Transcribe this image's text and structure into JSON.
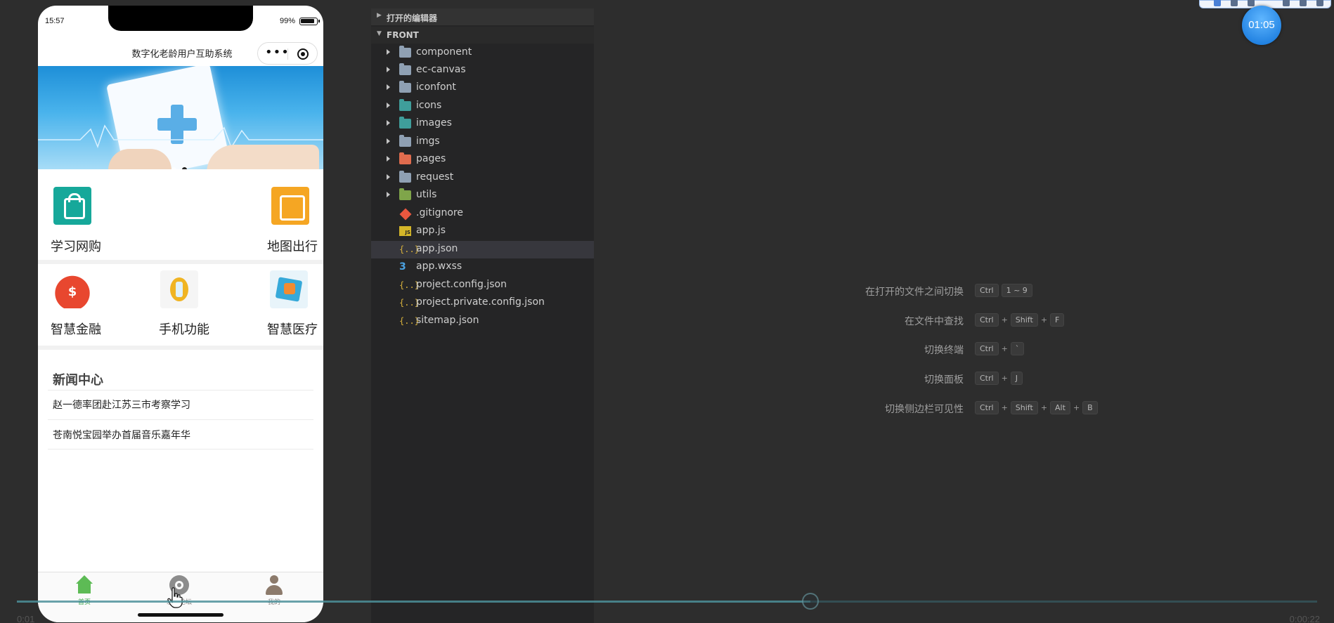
{
  "phone": {
    "status_time": "15:57",
    "battery": "99%",
    "nav_title": "数字化老龄用户互助系统",
    "grid_row1": [
      {
        "label": "学习网购",
        "icon": "shopping-bag-icon"
      },
      {
        "label": "地图出行",
        "icon": "map-icon"
      }
    ],
    "grid_row2": [
      {
        "label": "智慧金融",
        "icon": "money-bag-icon"
      },
      {
        "label": "手机功能",
        "icon": "phone-icon"
      },
      {
        "label": "智慧医疗",
        "icon": "medical-icon"
      }
    ],
    "news": {
      "title": "新闻中心",
      "items": [
        "赵一德率团赴江苏三市考察学习",
        "苍南悦宝园举办首届音乐嘉年华"
      ]
    },
    "tabs": [
      {
        "label": "首页",
        "icon": "home-icon",
        "active": true
      },
      {
        "label": "求助论坛",
        "icon": "forum-icon",
        "active": false
      },
      {
        "label": "我的",
        "icon": "user-icon",
        "active": false
      }
    ]
  },
  "explorer": {
    "open_editors": "打开的编辑器",
    "root": "FRONT",
    "folders": [
      "component",
      "ec-canvas",
      "iconfont",
      "icons",
      "images",
      "imgs",
      "pages",
      "request",
      "utils"
    ],
    "files": [
      ".gitignore",
      "app.js",
      "app.json",
      "app.wxss",
      "project.config.json",
      "project.private.config.json",
      "sitemap.json"
    ],
    "selected": "app.json"
  },
  "editor": {
    "shortcuts": [
      {
        "label": "在打开的文件之间切换",
        "keys": [
          "Ctrl",
          "1 ~ 9"
        ]
      },
      {
        "label": "在文件中查找",
        "keys": [
          "Ctrl",
          "+",
          "Shift",
          "+",
          "F"
        ]
      },
      {
        "label": "切换终端",
        "keys": [
          "Ctrl",
          "+",
          "`"
        ]
      },
      {
        "label": "切换面板",
        "keys": [
          "Ctrl",
          "+",
          "J"
        ]
      },
      {
        "label": "切换侧边栏可见性",
        "keys": [
          "Ctrl",
          "+",
          "Shift",
          "+",
          "Alt",
          "+",
          "B"
        ]
      }
    ]
  },
  "player": {
    "timer": "01:05",
    "progress": 0.61,
    "time_left": "0:01",
    "time_right": "0:00:22"
  }
}
